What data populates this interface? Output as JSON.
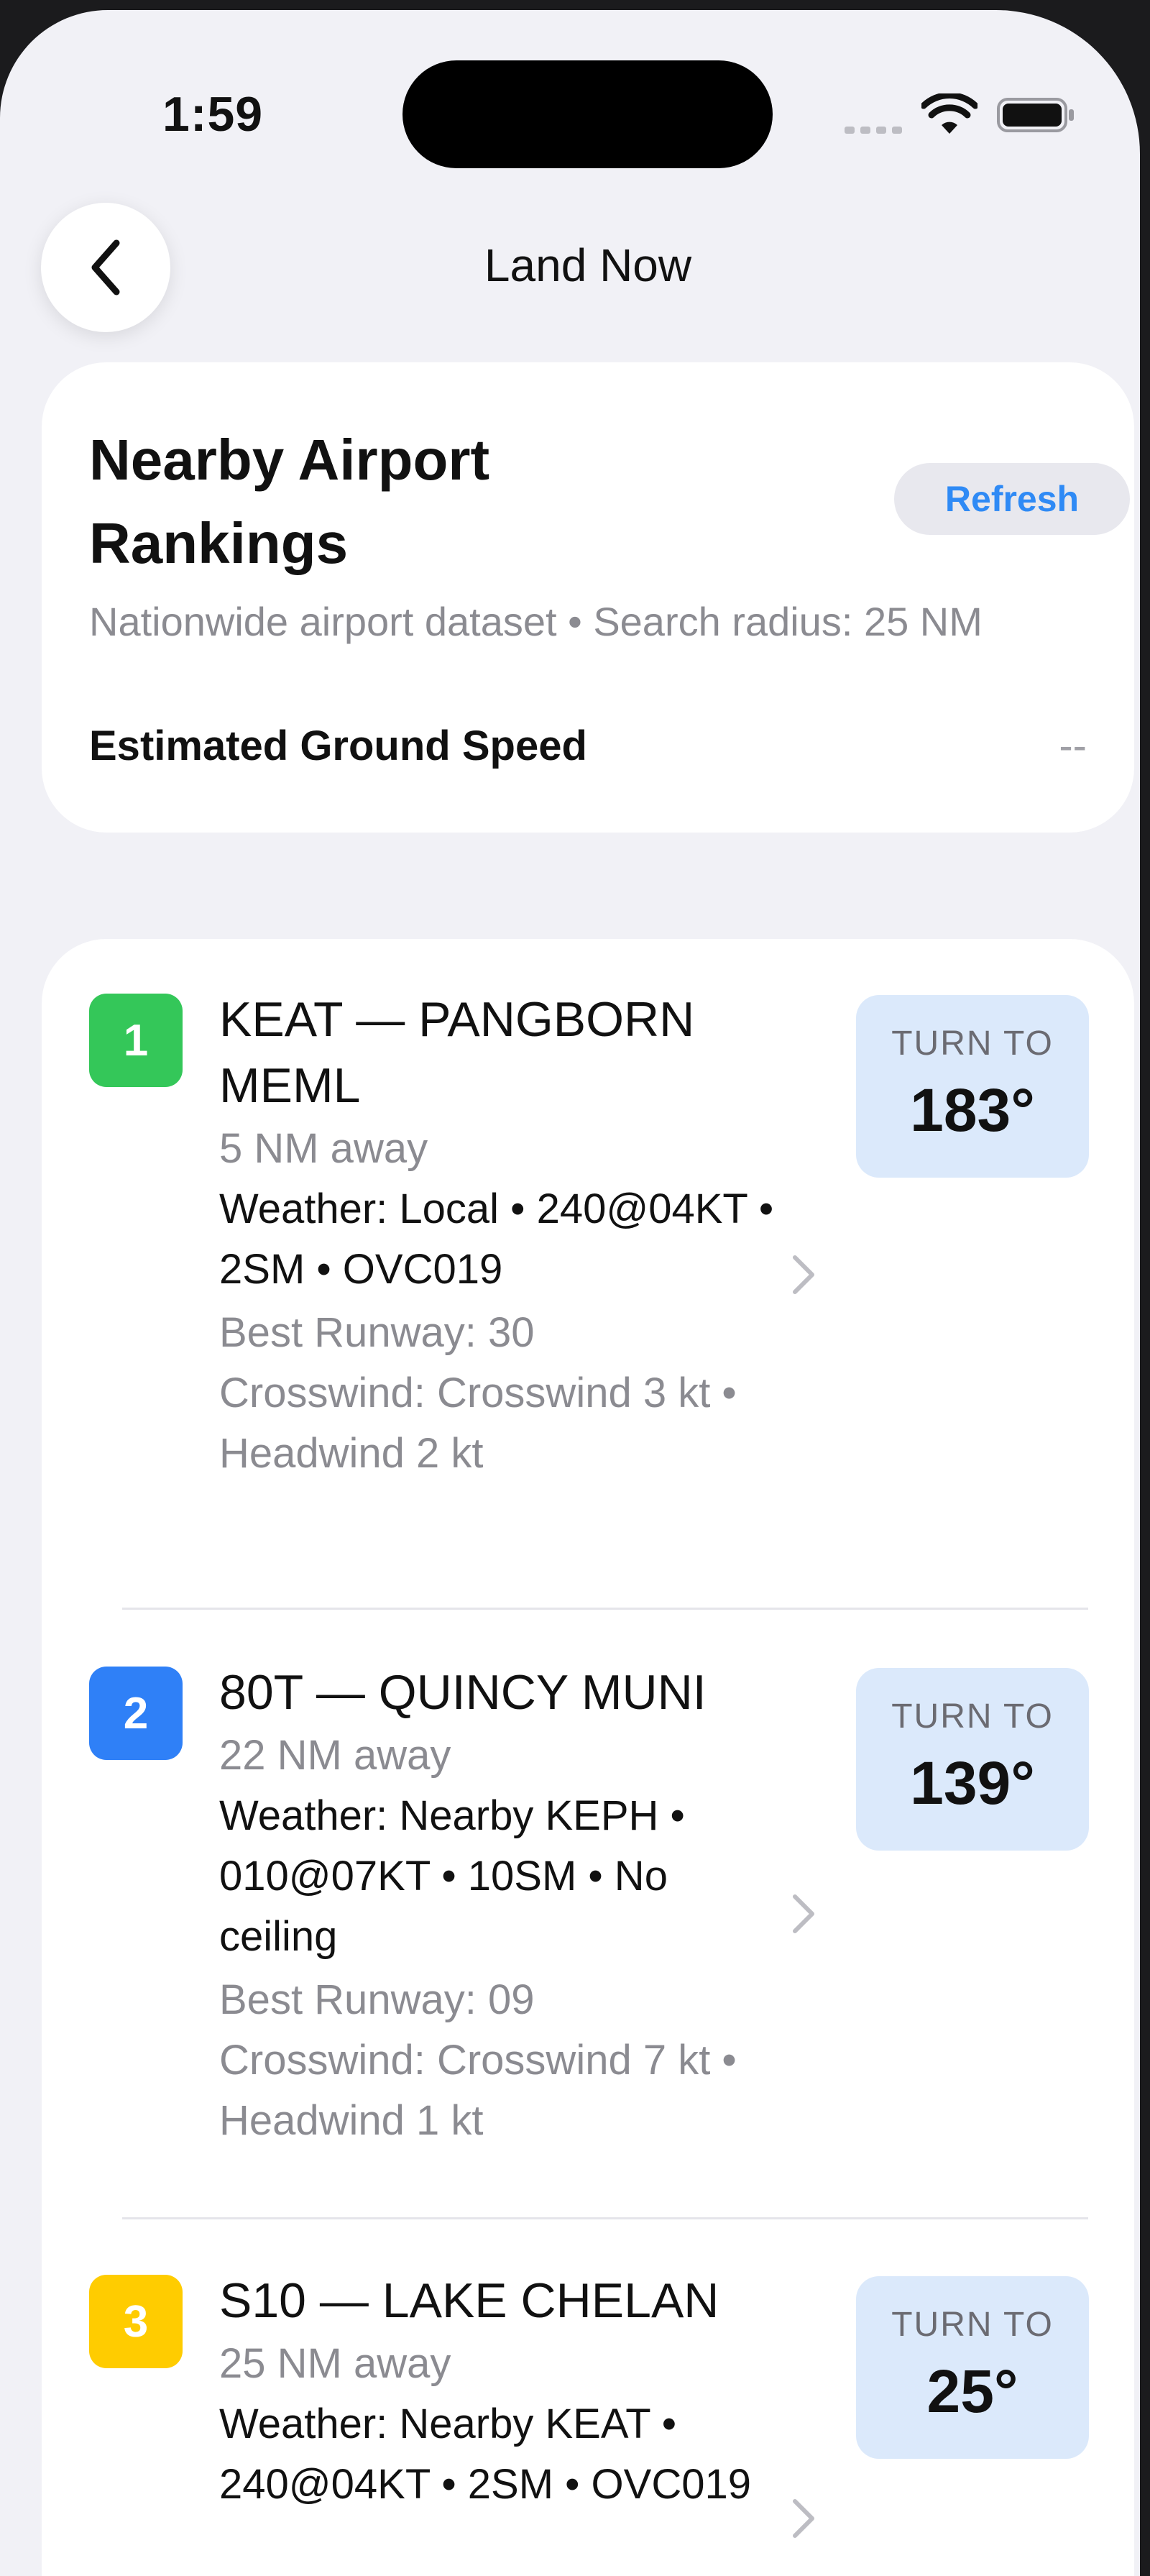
{
  "status_bar": {
    "time": "1:59"
  },
  "nav": {
    "title": "Land Now",
    "back_icon": "chevron-left-icon"
  },
  "header": {
    "title": "Nearby Airport Rankings",
    "refresh_label": "Refresh",
    "subtitle": "Nationwide airport dataset • Search radius: 25 NM",
    "ground_speed_label": "Estimated Ground Speed",
    "ground_speed_value": "--"
  },
  "colors": {
    "rank_1": "#34c759",
    "rank_2": "#2f80f7",
    "rank_3": "#ffcc00",
    "accent": "#2f8af5",
    "turn_box": "#dbe9fb"
  },
  "airports": [
    {
      "rank": "1",
      "name": "KEAT — PANGBORN MEML",
      "distance": "5 NM away",
      "weather": "Weather: Local • 240@04KT • 2SM • OVC019",
      "runway": "Best Runway: 30",
      "crosswind": "Crosswind: Crosswind 3 kt • Headwind 2 kt",
      "turn_label": "TURN TO",
      "turn_value": "183°"
    },
    {
      "rank": "2",
      "name": "80T — QUINCY MUNI",
      "distance": "22 NM away",
      "weather": "Weather: Nearby KEPH • 010@07KT • 10SM • No ceiling",
      "runway": "Best Runway: 09",
      "crosswind": "Crosswind: Crosswind 7 kt • Headwind 1 kt",
      "turn_label": "TURN TO",
      "turn_value": "139°"
    },
    {
      "rank": "3",
      "name": "S10 — LAKE CHELAN",
      "distance": "25 NM away",
      "weather": "Weather: Nearby KEAT • 240@04KT • 2SM • OVC019",
      "runway": "",
      "crosswind": "",
      "turn_label": "TURN TO",
      "turn_value": "25°"
    }
  ]
}
